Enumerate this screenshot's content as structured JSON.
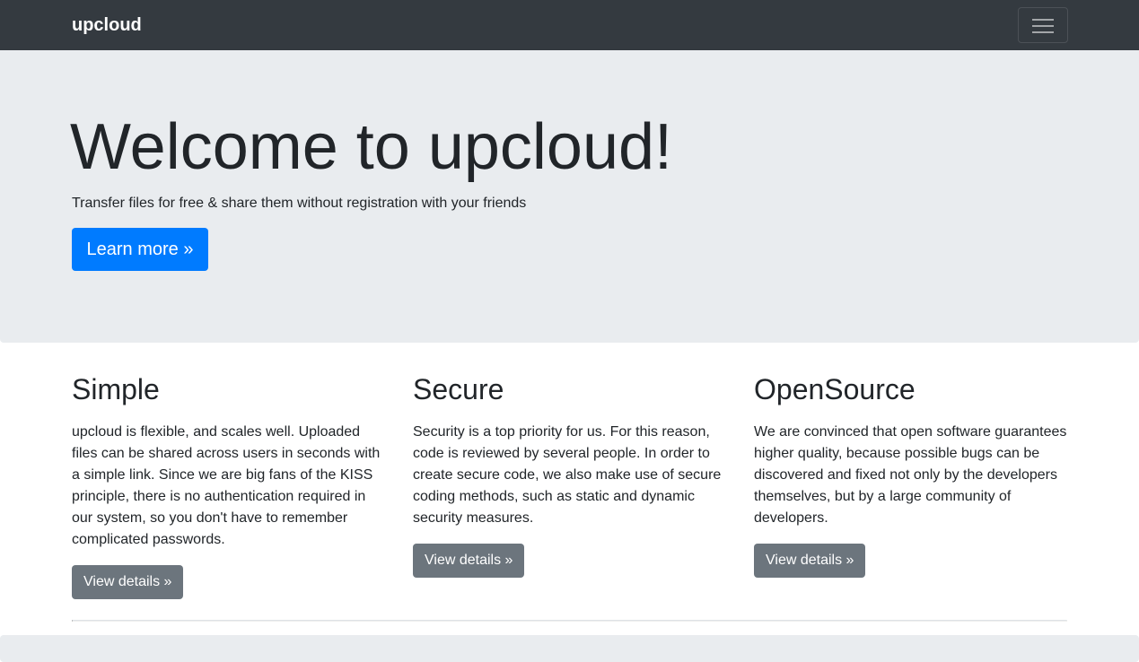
{
  "navbar": {
    "brand": "upcloud",
    "toggler_icon": "hamburger-menu-icon"
  },
  "hero": {
    "title": "Welcome to upcloud!",
    "lead": "Transfer files for free & share them without registration with your friends",
    "button_label": "Learn more »"
  },
  "features": [
    {
      "title": "Simple",
      "text": "upcloud is flexible, and scales well. Uploaded files can be shared across users in seconds with a simple link. Since we are big fans of the KISS principle, there is no authentication required in our system, so you don't have to remember complicated passwords.",
      "button_label": "View details »"
    },
    {
      "title": "Secure",
      "text": "Security is a top priority for us. For this reason, code is reviewed by several people. In order to create secure code, we also make use of secure coding methods, such as static and dynamic security measures.",
      "button_label": "View details »"
    },
    {
      "title": "OpenSource",
      "text": "We are convinced that open software guarantees higher quality, because possible bugs can be discovered and fixed not only by the developers themselves, but by a large community of developers.",
      "button_label": "View details »"
    }
  ],
  "colors": {
    "navbar_bg": "#343a40",
    "jumbotron_bg": "#e9ecef",
    "primary": "#007bff",
    "secondary": "#6c757d"
  }
}
